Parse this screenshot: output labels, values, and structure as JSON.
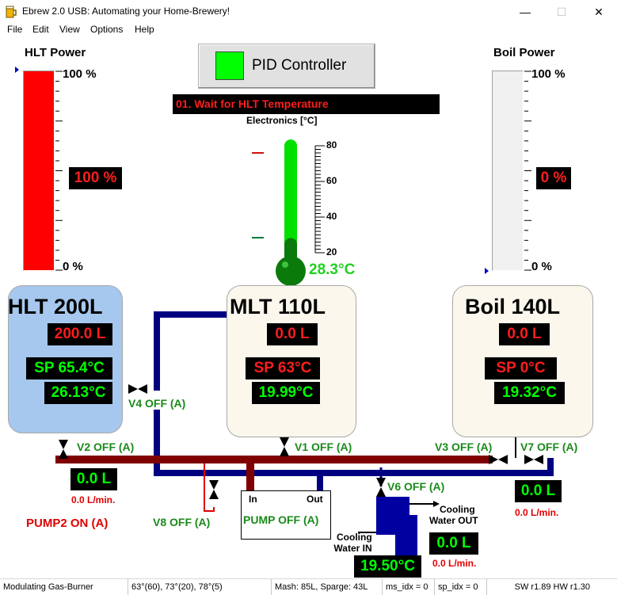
{
  "window": {
    "title": "Ebrew 2.0 USB: Automating your Home-Brewery!"
  },
  "menu": [
    "File",
    "Edit",
    "View",
    "Options",
    "Help"
  ],
  "hlt_power": {
    "label": "HLT Power",
    "top": "100  %",
    "bottom": "0  %",
    "value": "100 %",
    "level": 1.0,
    "color": "#ff0000"
  },
  "boil_power": {
    "label": "Boil Power",
    "top": "100  %",
    "bottom": "0  %",
    "value": "0 %",
    "level": 0.0
  },
  "pid": {
    "label": "PID Controller",
    "indicator_color": "#00ff00"
  },
  "state": {
    "text": "01. Wait for HLT Temperature"
  },
  "electronics": {
    "label": "Electronics [°C]",
    "scale": [
      "80",
      "60",
      "40",
      "20"
    ],
    "value": "28.3°C",
    "range": [
      20,
      80
    ],
    "level": 28.3
  },
  "hlt": {
    "title": "HLT 200L",
    "volume": "200.0 L",
    "setpoint": "SP 65.4°C",
    "temp": "26.13°C"
  },
  "mlt": {
    "title": "MLT 110L",
    "volume": "0.0 L",
    "setpoint": "SP  63°C",
    "temp": "19.99°C"
  },
  "boil": {
    "title": "Boil 140L",
    "volume": "0.0 L",
    "setpoint": "SP   0°C",
    "temp": "19.32°C"
  },
  "valves": {
    "v1": "V1 OFF (A)",
    "v2": "V2 OFF (A)",
    "v3": "V3 OFF (A)",
    "v4": "V4 OFF (A)",
    "v6": "V6 OFF (A)",
    "v7": "V7 OFF (A)",
    "v8": "V8 OFF (A)"
  },
  "flow1": {
    "volume": "0.0 L",
    "rate": "0.0 L/min."
  },
  "flow2": {
    "volume": "0.0 L",
    "rate": "0.0 L/min."
  },
  "flow3": {
    "volume": "0.0 L",
    "rate": "0.0 L/min."
  },
  "pump2": "PUMP2 ON (A)",
  "pump": {
    "in": "In",
    "out": "Out",
    "status": "PUMP OFF (A)"
  },
  "cooling": {
    "water_out": "Cooling\nWater OUT",
    "water_in": "Cooling\nWater IN",
    "out_l1": "Cooling",
    "out_l2": "Water OUT",
    "in_l1": "Cooling",
    "in_l2": "Water IN",
    "temp": "19.50°C"
  },
  "statusbar": [
    "Modulating Gas-Burner",
    "63°(60), 73°(20), 78°(5)",
    "Mash: 85L, Sparge: 43L",
    "ms_idx = 0",
    "sp_idx = 0",
    "SW r1.89 HW r1.30"
  ],
  "colors": {
    "pipe_blue": "#000080",
    "pipe_red": "#7f0000",
    "hlt_tank": "#a6c8ee",
    "tank_cream": "#fbf7ec",
    "cooling_blue": "#0000a0"
  }
}
